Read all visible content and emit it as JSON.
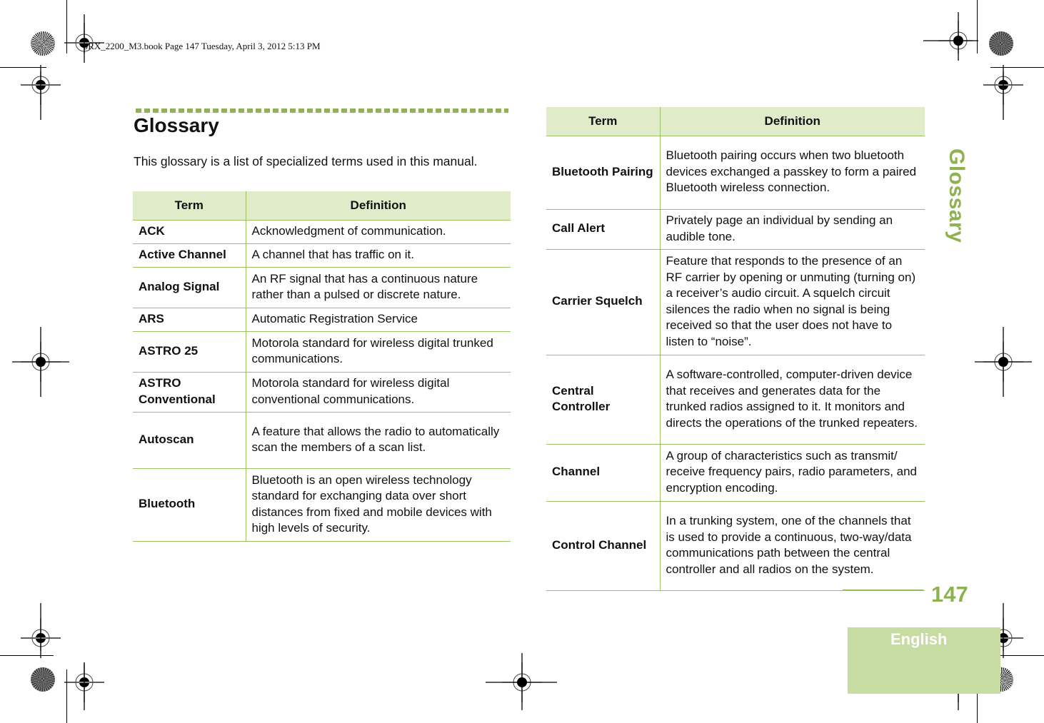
{
  "slug": "SRX_2200_M3.book  Page 147  Tuesday, April 3, 2012  5:13 PM",
  "heading": {
    "title": "Glossary",
    "intro": "This glossary is a list of specialized terms used in this manual."
  },
  "side_tab": "Glossary",
  "page_number": "147",
  "language_tab": "English",
  "accent_color": "#8db24f",
  "header_fill_color": "#e0ecc9",
  "tables": {
    "left": {
      "headers": [
        "Term",
        "Definition"
      ],
      "rows": [
        {
          "term": "ACK",
          "definition": "Acknowledgment of communication."
        },
        {
          "term": "Active Channel",
          "definition": "A channel that has traffic on it."
        },
        {
          "term": "Analog Signal",
          "definition": "An RF signal that has a continuous nature rather than a pulsed or discrete nature."
        },
        {
          "term": "ARS",
          "definition": "Automatic Registration Service"
        },
        {
          "term": "ASTRO 25",
          "definition": "Motorola standard for wireless digital trunked communications."
        },
        {
          "term": "ASTRO Conventional",
          "definition": "Motorola standard for wireless digital conventional communications."
        },
        {
          "term": "Autoscan",
          "definition": "A feature that allows the radio to automatically scan the members of a scan list."
        },
        {
          "term": "Bluetooth",
          "definition": "Bluetooth is an open wireless technology standard for exchanging data over short distances from fixed and mobile devices with high levels of security."
        }
      ]
    },
    "right": {
      "headers": [
        "Term",
        "Definition"
      ],
      "rows": [
        {
          "term": "Bluetooth Pairing",
          "definition": "Bluetooth pairing occurs when two bluetooth devices exchanged a passkey to form a paired Bluetooth wireless connection."
        },
        {
          "term": "Call Alert",
          "definition": "Privately page an individual by sending an audible tone."
        },
        {
          "term": "Carrier Squelch",
          "definition": "Feature that responds to the presence of an RF carrier by opening or unmuting (turning on) a receiver’s audio circuit. A squelch circuit silences the radio when no signal is being received so that the user does not have to listen to “noise”."
        },
        {
          "term": "Central Controller",
          "definition": "A software-controlled, computer-driven device that receives and generates data for the trunked radios assigned to it. It monitors and directs the operations of the trunked repeaters."
        },
        {
          "term": "Channel",
          "definition": "A group of characteristics such as transmit/ receive frequency pairs, radio parameters, and encryption encoding."
        },
        {
          "term": "Control Channel",
          "definition": "In a trunking system, one of the channels that is used to provide a continuous, two-way/data communications path between the central controller and all radios on the system."
        }
      ]
    }
  }
}
